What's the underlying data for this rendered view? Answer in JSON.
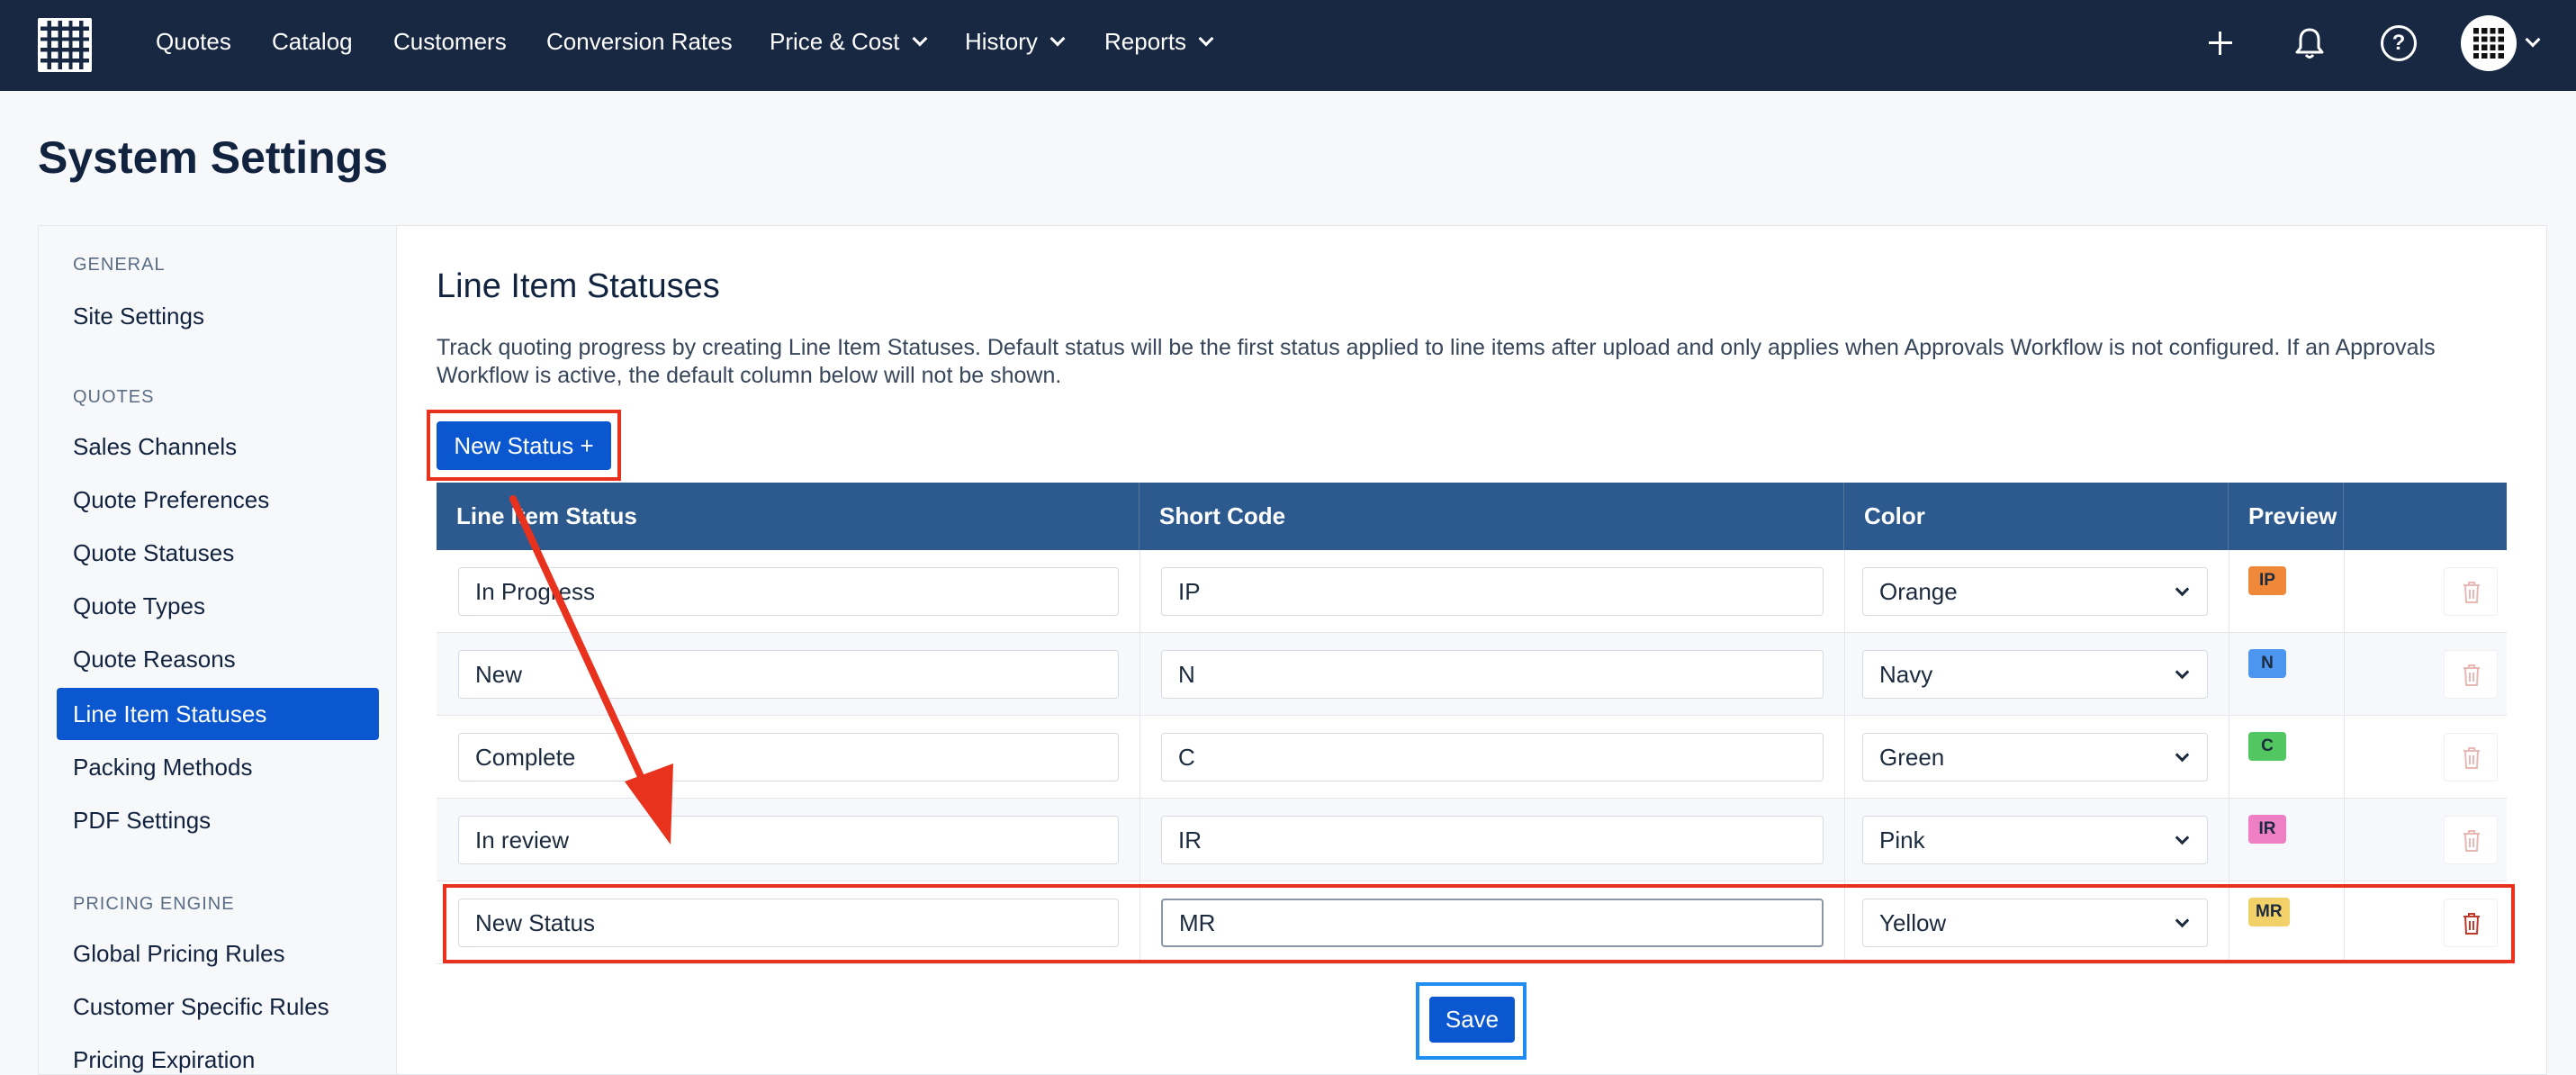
{
  "nav": {
    "items": [
      {
        "label": "Quotes",
        "dropdown": false
      },
      {
        "label": "Catalog",
        "dropdown": false
      },
      {
        "label": "Customers",
        "dropdown": false
      },
      {
        "label": "Conversion Rates",
        "dropdown": false
      },
      {
        "label": "Price & Cost",
        "dropdown": true
      },
      {
        "label": "History",
        "dropdown": true
      },
      {
        "label": "Reports",
        "dropdown": true
      }
    ],
    "help_glyph": "?"
  },
  "page": {
    "title": "System Settings"
  },
  "sidebar": {
    "sections": [
      {
        "label": "GENERAL",
        "items": [
          "Site Settings"
        ]
      },
      {
        "label": "QUOTES",
        "items": [
          "Sales Channels",
          "Quote Preferences",
          "Quote Statuses",
          "Quote Types",
          "Quote Reasons",
          "Line Item Statuses",
          "Packing Methods",
          "PDF Settings"
        ]
      },
      {
        "label": "PRICING ENGINE",
        "items": [
          "Global Pricing Rules",
          "Customer Specific Rules",
          "Pricing Expiration"
        ]
      }
    ],
    "active_item": "Line Item Statuses"
  },
  "main": {
    "title": "Line Item Statuses",
    "description": "Track quoting progress by creating Line Item Statuses. Default status will be the first status applied to line items after upload and only applies when Approvals Workflow is not configured. If an Approvals Workflow is active, the default column below will not be shown.",
    "new_status_label": "New Status +",
    "save_label": "Save",
    "columns": [
      "Line Item Status",
      "Short Code",
      "Color",
      "Preview"
    ],
    "rows": [
      {
        "status": "In Progress",
        "short_code": "IP",
        "color": "Orange",
        "badge_color": "#f0883a"
      },
      {
        "status": "New",
        "short_code": "N",
        "color": "Navy",
        "badge_color": "#4d96f0"
      },
      {
        "status": "Complete",
        "short_code": "C",
        "color": "Green",
        "badge_color": "#52c660"
      },
      {
        "status": "In review",
        "short_code": "IR",
        "color": "Pink",
        "badge_color": "#ee7fc4"
      },
      {
        "status": "New Status",
        "short_code": "MR",
        "color": "Yellow",
        "badge_color": "#f2d169"
      }
    ]
  },
  "colors": {
    "nav_bg": "#182742",
    "accent": "#0b57d0",
    "table_header": "#2d5a8e",
    "annotation_red": "#e8321e",
    "annotation_blue": "#1f8ef0"
  }
}
